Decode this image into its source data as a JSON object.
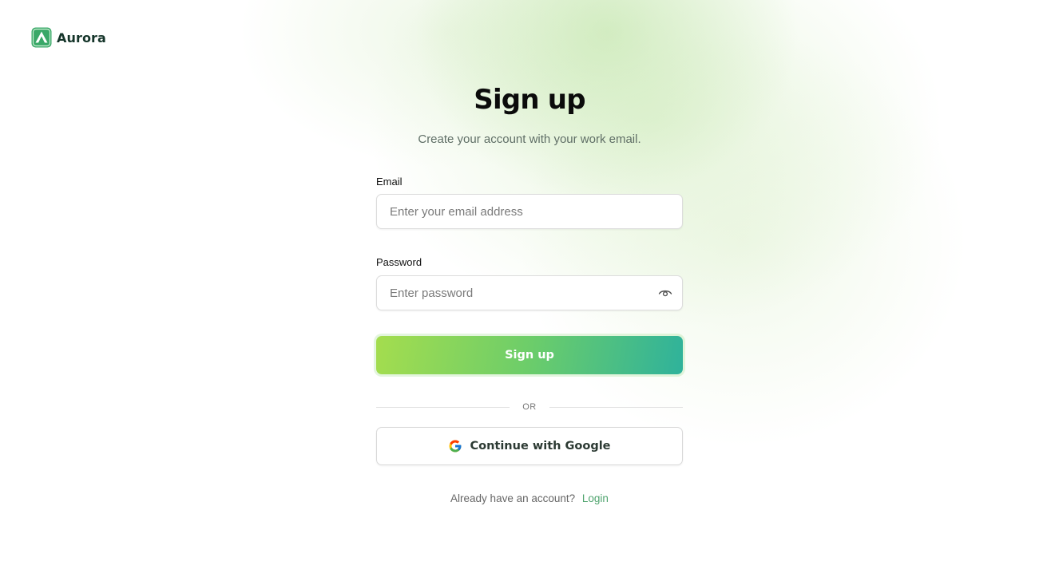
{
  "brand": {
    "name": "Aurora",
    "colors": {
      "primary_gradient_start": "#a4dd4e",
      "primary_gradient_mid": "#6ccd6a",
      "primary_gradient_end": "#2fb29b",
      "link": "#4fa46e",
      "logo_mark": "#3aa868"
    }
  },
  "header": {
    "title": "Sign up",
    "subtitle": "Create your account with your work email."
  },
  "form": {
    "email": {
      "label": "Email",
      "placeholder": "Enter your email address",
      "value": ""
    },
    "password": {
      "label": "Password",
      "placeholder": "Enter password",
      "value": "",
      "toggle_icon": "eye-icon"
    },
    "submit_label": "Sign up"
  },
  "divider": {
    "label": "OR"
  },
  "google": {
    "label": "Continue with Google",
    "icon": "google-icon"
  },
  "footer": {
    "prompt": "Already have an account?",
    "link_label": "Login"
  }
}
